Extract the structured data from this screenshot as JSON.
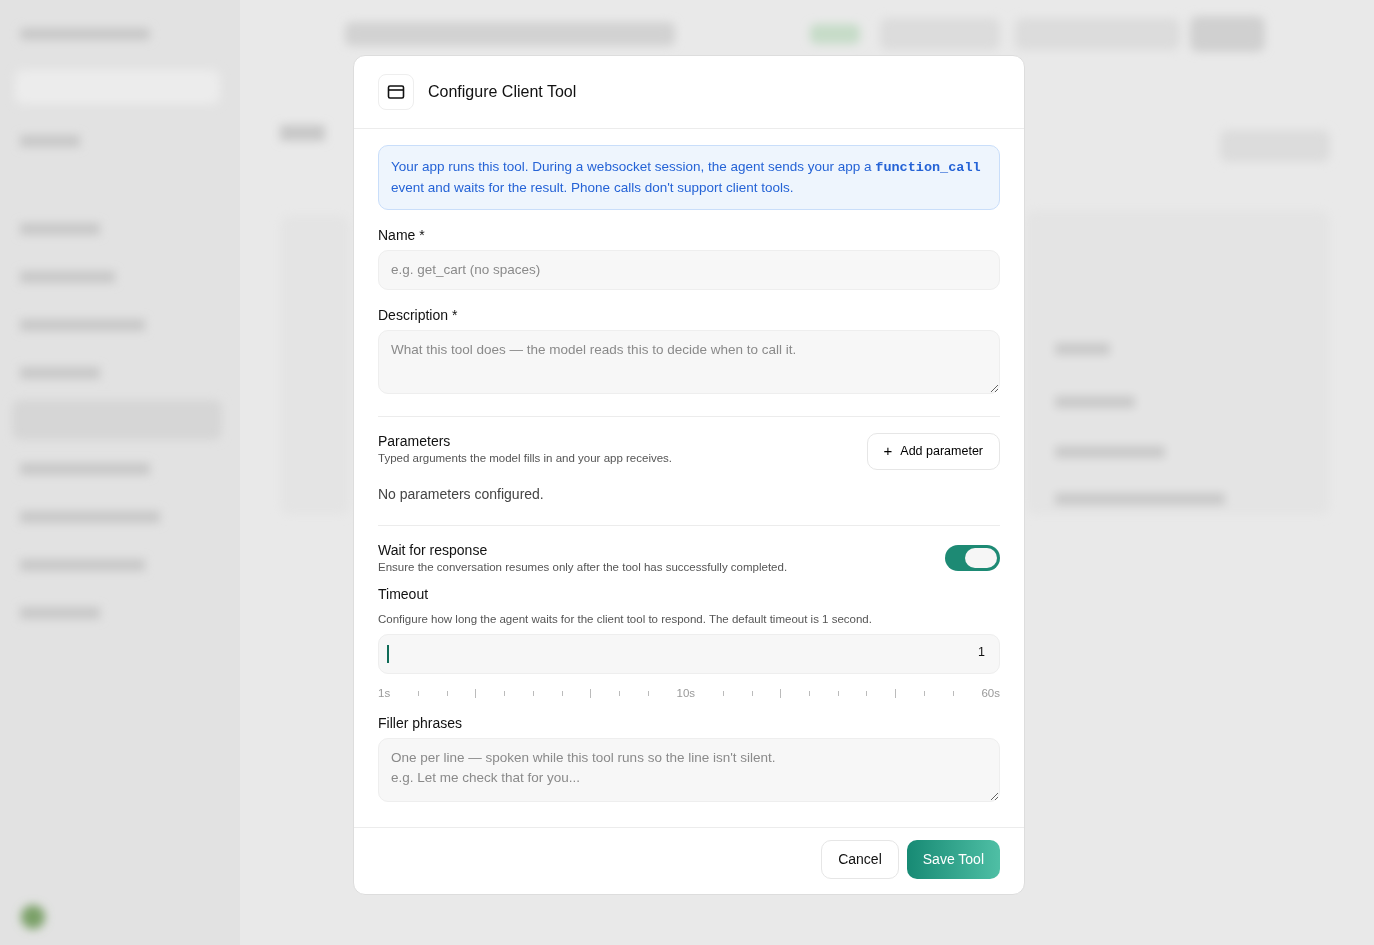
{
  "dialog": {
    "title": "Configure Client Tool",
    "notice": "Your app runs this tool. During a websocket session, the agent sends your app a **function_call** event and waits for the result. Phone calls don't support client tools.",
    "name_field": {
      "label": "Name *",
      "placeholder": "e.g. get_cart (no spaces)"
    },
    "description_field": {
      "label": "Description *",
      "placeholder": "What this tool does — the model reads this to decide when to call it."
    },
    "parameters": {
      "title": "Parameters",
      "subtitle": "Typed arguments the model fills in and your app receives.",
      "add_icon": "+",
      "add_button": "Add parameter",
      "empty_text": "No parameters configured."
    },
    "wait_for_response": {
      "title": "Wait for response",
      "subtitle": "Ensure the conversation resumes only after the tool has successfully completed.",
      "on": true
    },
    "timeout": {
      "title": "Timeout",
      "subtitle": "Configure how long the agent waits for the client tool to respond. The default timeout is 1 second.",
      "value": "1",
      "level": 0,
      "scale": [
        "1s",
        "10s",
        "60s"
      ]
    },
    "filler_field": {
      "label": "Filler phrases",
      "placeholder": "One per line — spoken while this tool runs so the line isn't silent.\ne.g. Let me check that for you..."
    },
    "buttons": [
      {
        "label": "Cancel",
        "kind": "secondary"
      },
      {
        "label": "Save Tool",
        "kind": "primary"
      }
    ]
  }
}
